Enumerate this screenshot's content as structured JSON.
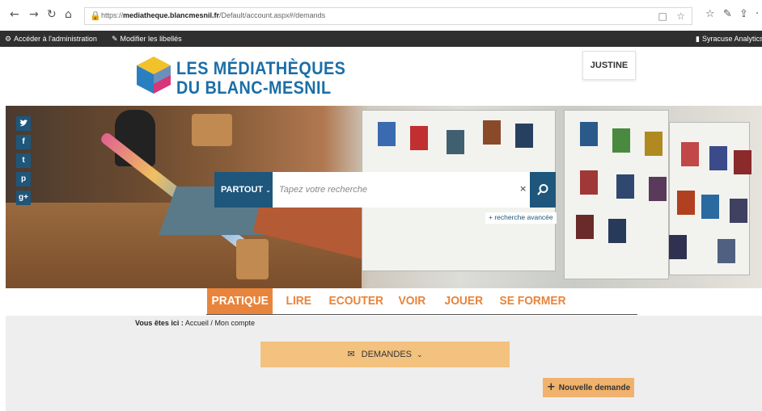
{
  "browser": {
    "back_icon": "←",
    "forward_icon": "→",
    "reload_icon": "↻",
    "home_icon": "⌂",
    "url_prefix": "https://",
    "url_domain": "mediatheque.blancmesnil.fr",
    "url_path": "/Default/account.aspx#/demands",
    "reading_icon": "□",
    "favorite_icon": "☆",
    "favorites_icon": "☆",
    "notes_icon": "✎",
    "share_icon": "⇪",
    "more_icon": "·"
  },
  "admin_bar": {
    "admin_label": "Accéder à l'administration",
    "labels_label": "Modifier les libellés",
    "analytics_label": "Syracuse Analytics"
  },
  "header": {
    "logo_line1": "LES MÉDIATHÈQUES",
    "logo_line2": "DU BLANC-MESNIL",
    "user_label": "JUSTINE"
  },
  "social": [
    "f",
    "t",
    "p",
    "g+"
  ],
  "search": {
    "scope_label": "PARTOUT",
    "placeholder": "Tapez votre recherche",
    "clear_icon": "×",
    "advanced_label": "+ recherche avancée"
  },
  "nav": {
    "items": [
      "PRATIQUE",
      "LIRE",
      "ECOUTER",
      "VOIR",
      "JOUER",
      "SE FORMER"
    ],
    "active": "PRATIQUE"
  },
  "breadcrumb": {
    "label": "Vous êtes ici :",
    "home": "Accueil",
    "separator": "/",
    "current": "Mon compte"
  },
  "demands": {
    "label": "DEMANDES",
    "new_label": "Nouvelle demande"
  },
  "colors": {
    "brand_blue": "#1e567c",
    "accent_orange": "#e8843c",
    "demands_bg": "#f3c27f",
    "button_bg": "#f0b26d"
  }
}
